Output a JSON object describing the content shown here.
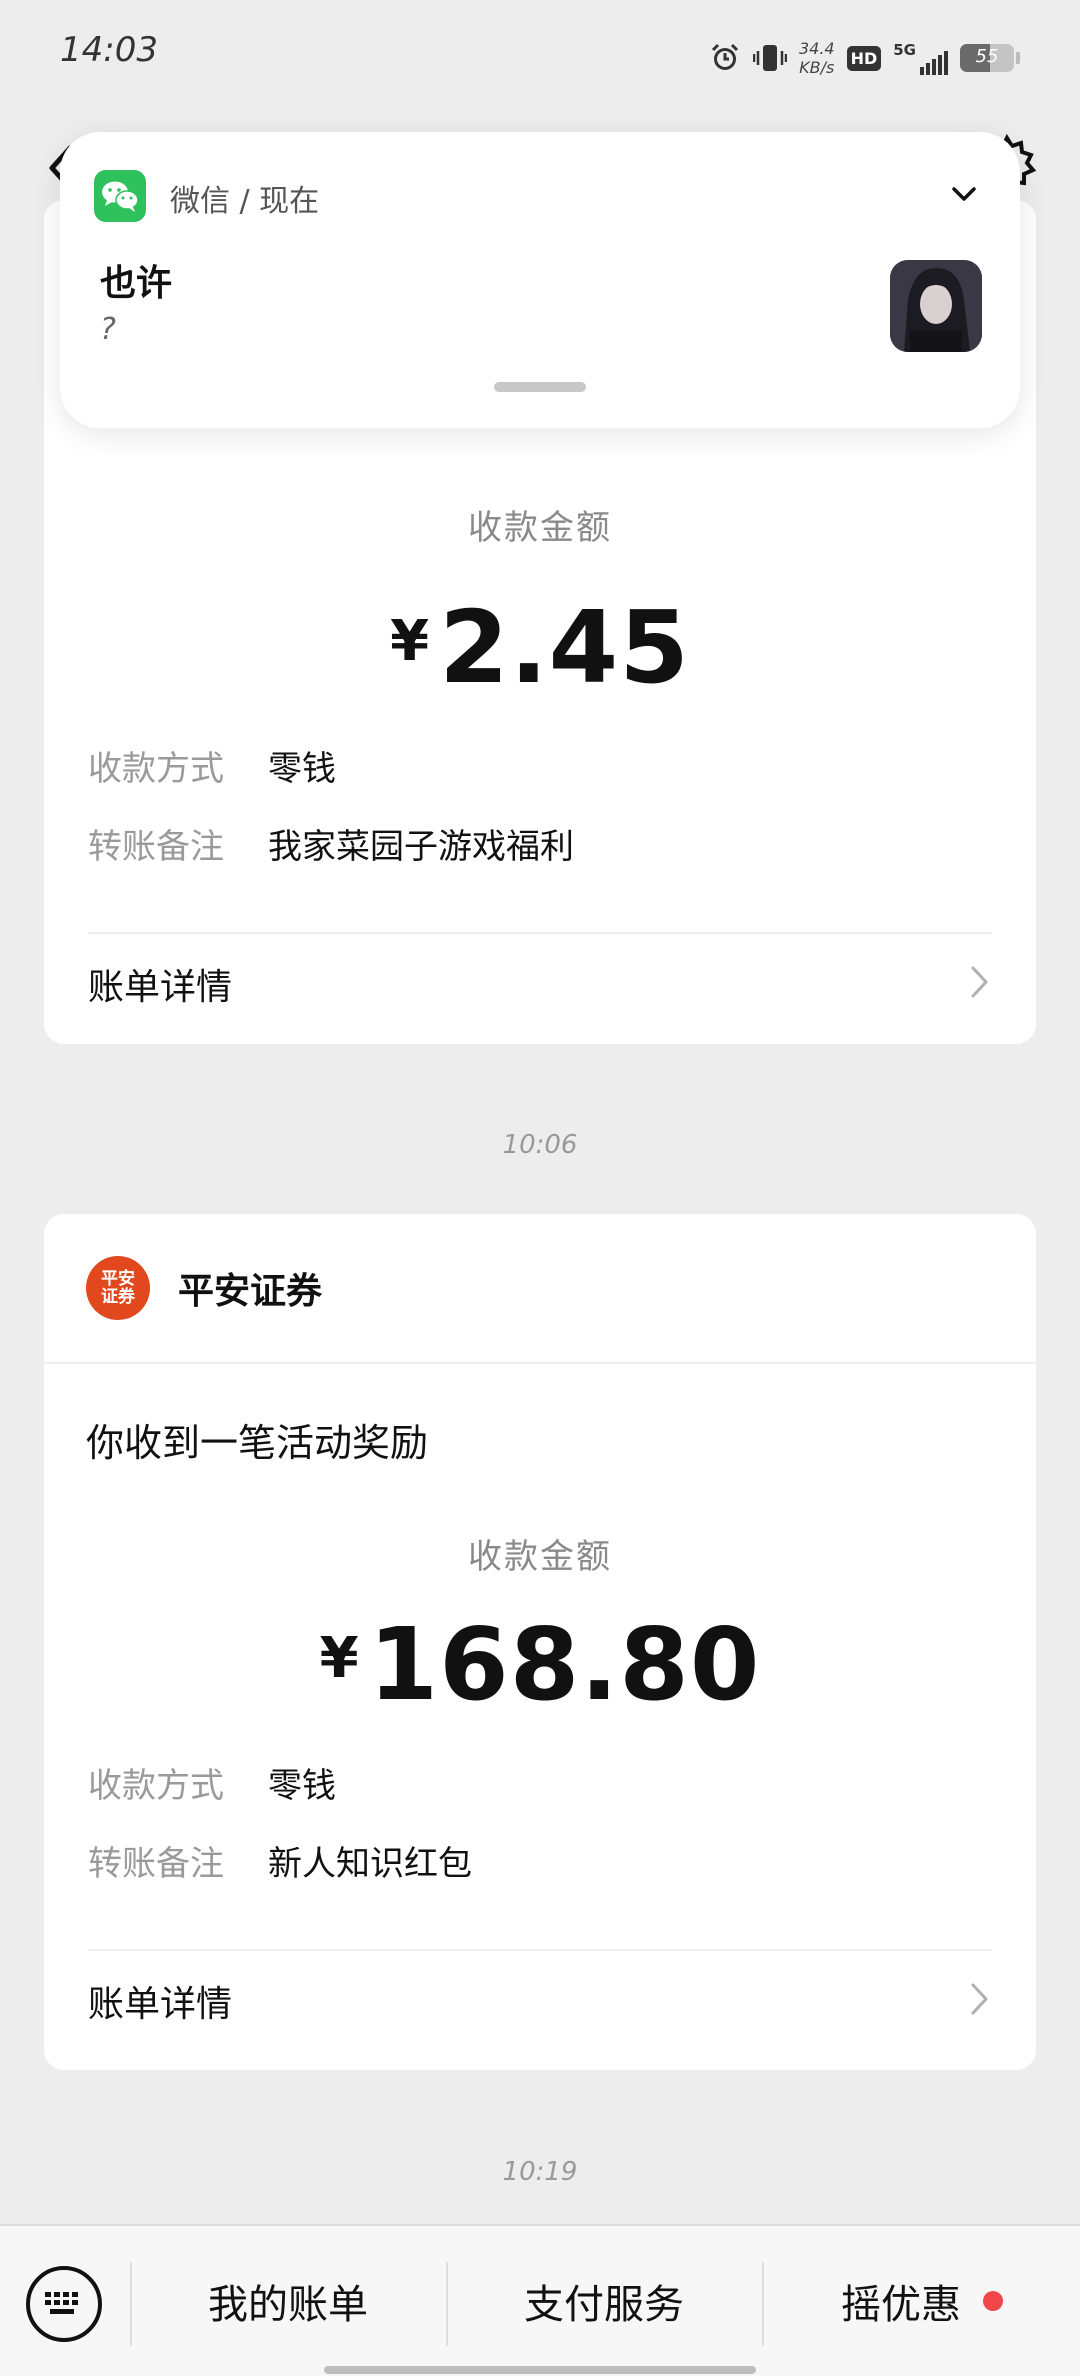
{
  "status_bar": {
    "time": "14:03",
    "net_speed_value": "34.4",
    "net_speed_unit": "KB/s",
    "hd_label": "HD",
    "network_label": "5G",
    "battery_level": "55"
  },
  "notification": {
    "app_name": "微信 / 现在",
    "sender": "也许",
    "message": "?"
  },
  "cards": [
    {
      "amount_label": "收款金额",
      "currency": "¥",
      "amount": "2.45",
      "method_key": "收款方式",
      "method_value": "零钱",
      "remark_key": "转账备注",
      "remark_value": "我家菜园子游戏福利",
      "bill_detail": "账单详情"
    },
    {
      "merchant_logo_line1": "平安",
      "merchant_logo_line2": "证券",
      "merchant": "平安证券",
      "subtitle": "你收到一笔活动奖励",
      "amount_label": "收款金额",
      "currency": "¥",
      "amount": "168.80",
      "method_key": "收款方式",
      "method_value": "零钱",
      "remark_key": "转账备注",
      "remark_value": "新人知识红包",
      "bill_detail": "账单详情"
    }
  ],
  "times": [
    "10:06",
    "10:19"
  ],
  "bottom_bar": {
    "tabs": [
      "我的账单",
      "支付服务",
      "摇优惠"
    ]
  },
  "colors": {
    "background": "#ededed",
    "wechat_green": "#2ec15c",
    "merchant_orange": "#e2481e",
    "badge_red": "#f2474a"
  }
}
